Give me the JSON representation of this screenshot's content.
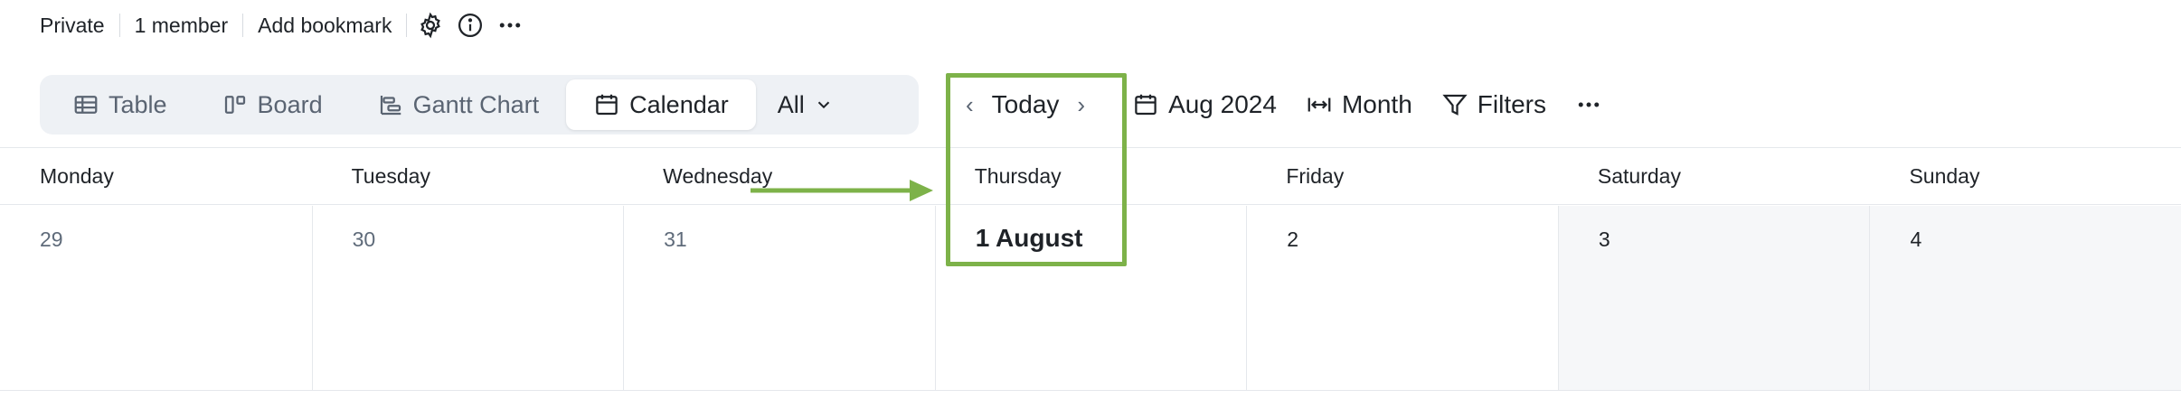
{
  "meta": {
    "visibility": "Private",
    "members": "1 member",
    "bookmark": "Add bookmark",
    "icons": [
      "gear-icon",
      "info-icon",
      "more-icon"
    ]
  },
  "views": {
    "table": "Table",
    "board": "Board",
    "gantt": "Gantt Chart",
    "calendar": "Calendar",
    "all": "All"
  },
  "toolbar": {
    "prev": "‹",
    "today": "Today",
    "next": "›",
    "date": "Aug 2024",
    "range": "Month",
    "filters": "Filters",
    "more": "•••"
  },
  "calendar": {
    "weekdays": [
      "Monday",
      "Tuesday",
      "Wednesday",
      "Thursday",
      "Friday",
      "Saturday",
      "Sunday"
    ],
    "dates": [
      "29",
      "30",
      "31",
      "1 August",
      "2",
      "3",
      "4"
    ]
  },
  "colors": {
    "highlight": "#7db249",
    "active_view_bg": "#ffffff",
    "switcher_bg": "#eef1f5",
    "weekend_bg": "#f6f7f9"
  }
}
